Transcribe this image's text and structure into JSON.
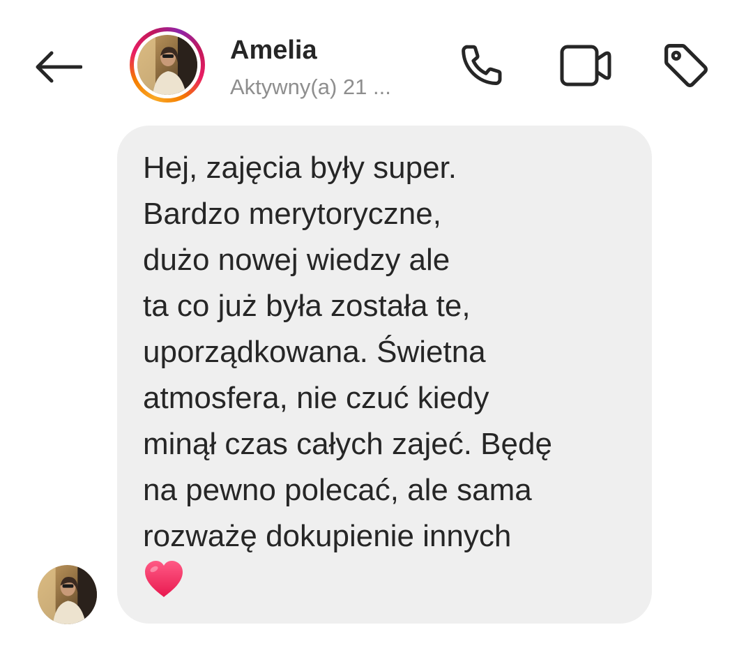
{
  "header": {
    "contact_name": "Amelia",
    "status": "Aktywny(a) 21 ...",
    "icons": {
      "back": "arrow-left-icon",
      "call": "phone-icon",
      "video": "video-camera-icon",
      "tag": "tag-icon"
    }
  },
  "message": {
    "lines": [
      "Hej, zajęcia były super.",
      "Bardzo merytoryczne,",
      "dużo nowej wiedzy ale",
      "ta co już była została te,",
      "uporządkowana. Świetna",
      "atmosfera, nie czuć kiedy",
      "minął czas całych zajeć. Będę",
      "na pewno polecać, ale sama",
      "rozważę dokupienie innych"
    ],
    "emoji": "heart-icon",
    "bubble_color": "#efefef"
  },
  "colors": {
    "text": "#262626",
    "secondary_text": "#8e8e8e",
    "story_ring_start": "#f9a825",
    "story_ring_end": "#c2185b",
    "heart": "#ff3b6b"
  }
}
